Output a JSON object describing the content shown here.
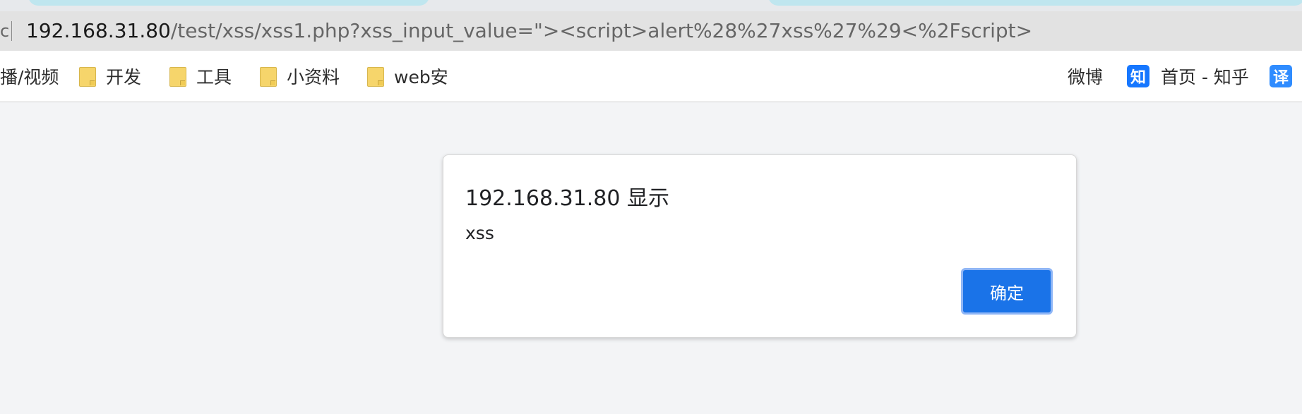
{
  "browser": {
    "address_bar_left_fragment": "c",
    "url_host": "192.168.31.80",
    "url_path": "/test/xss/xss1.php?xss_input_value=\"><script>alert%28%27xss%27%29<%2Fscript>",
    "colors": {
      "tab_strip": "#e7e9ec",
      "tab_accent": "#bfe6ef",
      "address_bar": "#e2e2e2",
      "bookmarks_bar": "#ffffff",
      "content_bg": "#f3f4f6"
    }
  },
  "bookmarks": [
    {
      "label": "播/视频",
      "icon": "none"
    },
    {
      "label": "开发",
      "icon": "folder-icon"
    },
    {
      "label": "工具",
      "icon": "folder-icon"
    },
    {
      "label": "小资料",
      "icon": "folder-icon"
    },
    {
      "label": "web安",
      "icon": "folder-icon"
    },
    {
      "label": "微博",
      "icon": "none"
    },
    {
      "label": "首页 - 知乎",
      "icon": "zhihu-icon",
      "badge": "知"
    },
    {
      "label": "",
      "icon": "fanyi-icon",
      "badge": "译"
    }
  ],
  "dialog": {
    "title": "192.168.31.80 显示",
    "message": "xss",
    "confirm_label": "确定",
    "colors": {
      "button": "#1a73e8",
      "button_outline": "#8fb6f6"
    }
  }
}
